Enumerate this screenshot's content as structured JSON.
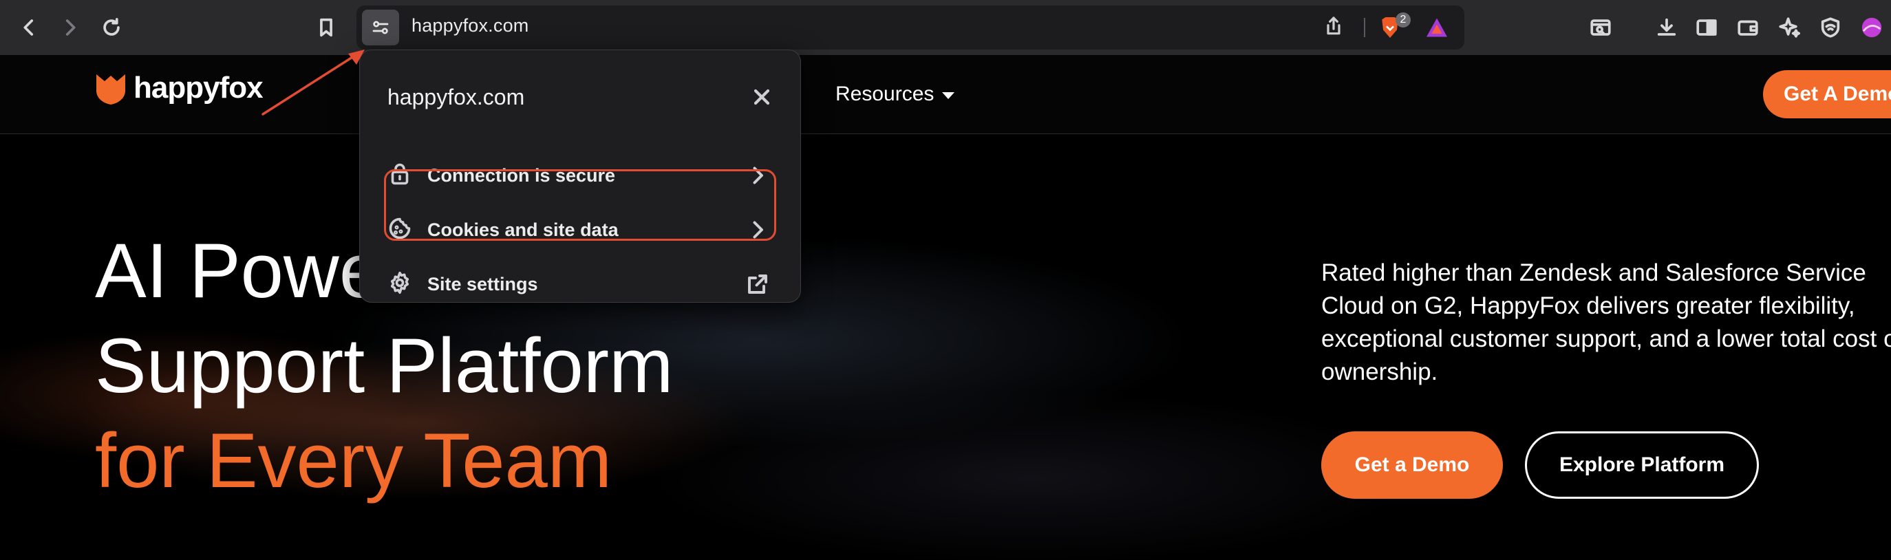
{
  "browser": {
    "url": "happyfox.com",
    "brave_shield_count": "2"
  },
  "site": {
    "logo_text": "happyfox",
    "nav": {
      "resources_label": "Resources",
      "cta_label": "Get A Demo"
    },
    "hero": {
      "title_line1": "AI Powe",
      "title_line2": "Support Platform",
      "title_line3": "for Every Team",
      "description": "Rated higher than Zendesk and Salesforce Service Cloud on G2, HappyFox delivers greater flexibility, exceptional customer support, and a lower total cost of ownership.",
      "primary_button": "Get a Demo",
      "secondary_button": "Explore Platform"
    }
  },
  "site_info_popover": {
    "title": "happyfox.com",
    "items": [
      {
        "label": "Connection is secure",
        "icon": "lock-icon",
        "trailing": "chevron-right-icon"
      },
      {
        "label": "Cookies and site data",
        "icon": "cookie-icon",
        "trailing": "chevron-right-icon",
        "highlighted": true
      },
      {
        "label": "Site settings",
        "icon": "gear-icon",
        "trailing": "external-link-icon"
      }
    ]
  },
  "colors": {
    "accent_orange": "#f36b2b",
    "annotation_red": "#e24c32",
    "toolbar_bg": "#2a2a2c",
    "popover_bg": "#1e1e20"
  }
}
